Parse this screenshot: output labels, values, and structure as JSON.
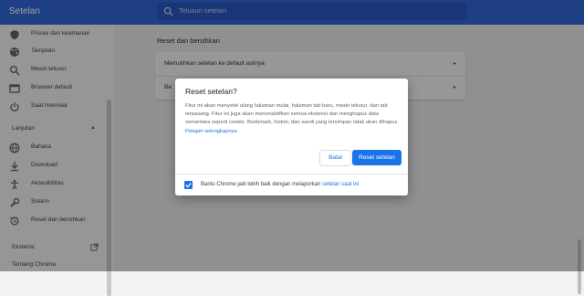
{
  "header": {
    "title": "Setelan",
    "search_placeholder": "Telusuri setelan"
  },
  "sidebar": {
    "items": [
      {
        "label": "Privasi dan keamanan",
        "icon": "shield-icon"
      },
      {
        "label": "Tampilan",
        "icon": "palette-icon"
      },
      {
        "label": "Mesin telusur",
        "icon": "search-icon"
      },
      {
        "label": "Browser default",
        "icon": "browser-icon"
      },
      {
        "label": "Saat memulai",
        "icon": "power-icon"
      }
    ],
    "advanced_label": "Lanjutan",
    "advanced_items": [
      {
        "label": "Bahasa",
        "icon": "globe-icon"
      },
      {
        "label": "Download",
        "icon": "download-icon"
      },
      {
        "label": "Aksesibilitas",
        "icon": "accessibility-icon"
      },
      {
        "label": "Sistem",
        "icon": "wrench-icon"
      },
      {
        "label": "Reset dan bersihkan",
        "icon": "history-icon"
      }
    ],
    "extensions_label": "Ekstensi",
    "about_label": "Tentang Chrome"
  },
  "main": {
    "section_title": "Reset dan bersihkan",
    "rows": [
      {
        "label": "Memulihkan setelan ke default aslinya"
      },
      {
        "label": "Be"
      }
    ]
  },
  "dialog": {
    "title": "Reset setelan?",
    "body": "Fitur ini akan menyetel ulang halaman mulai, halaman tab baru, mesin telusur, dan tab terpasang. Fitur ini juga akan menonaktifkan semua ekstensi dan menghapus data sementara seperti cookie. Bookmark, histori, dan sandi yang tersimpan tidak akan dihapus.",
    "learn_more": "Pelajari selengkapnya",
    "cancel_label": "Batal",
    "reset_label": "Reset setelan",
    "footer_text": "Bantu Chrome jadi lebih baik dengan melaporkan",
    "footer_link": "setelan saat ini",
    "checkbox_checked": true
  },
  "colors": {
    "header": "#3367d6",
    "accent": "#1a73e8"
  }
}
